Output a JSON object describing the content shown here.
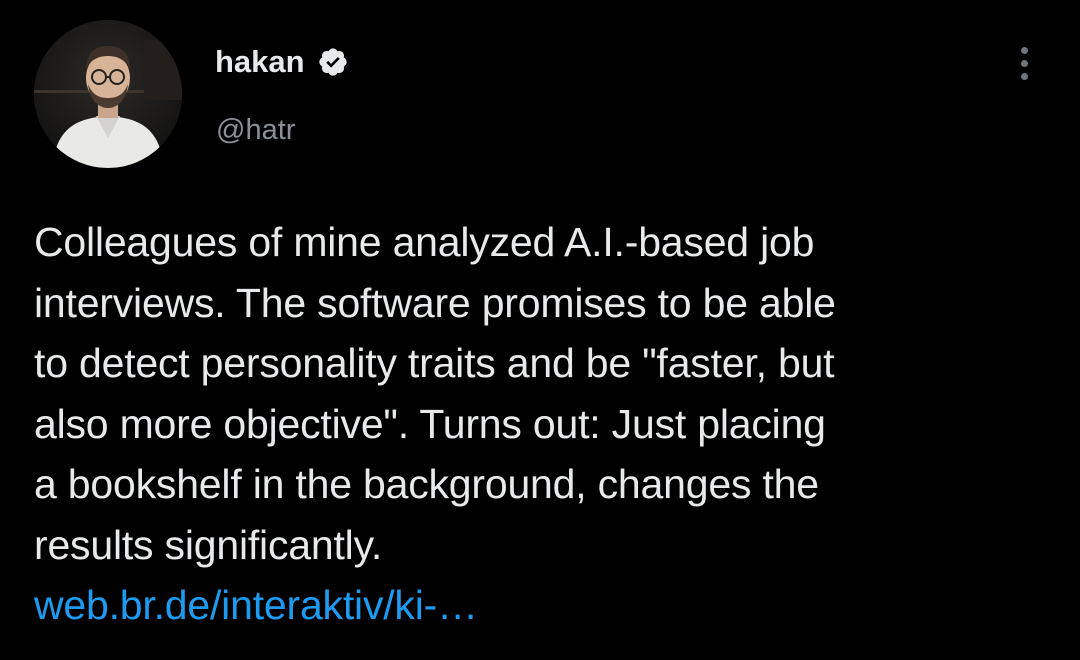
{
  "author": {
    "display_name": "hakan",
    "handle": "@hatr",
    "verified": true,
    "avatar_icon": "profile-photo"
  },
  "menu": {
    "icon": "more-vertical-icon"
  },
  "tweet": {
    "lines": [
      "Colleagues of mine analyzed A.I.-based job",
      "interviews. The software promises to be able",
      "to detect personality traits and be \"faster, but",
      "also more objective\". Turns out: Just placing",
      "a bookshelf in the background, changes the",
      "results significantly."
    ],
    "link_text": "web.br.de/interaktiv/ki-…"
  },
  "colors": {
    "background": "#000000",
    "text": "#e7e9ea",
    "secondary": "#8b9096",
    "link": "#1d9bf0"
  }
}
